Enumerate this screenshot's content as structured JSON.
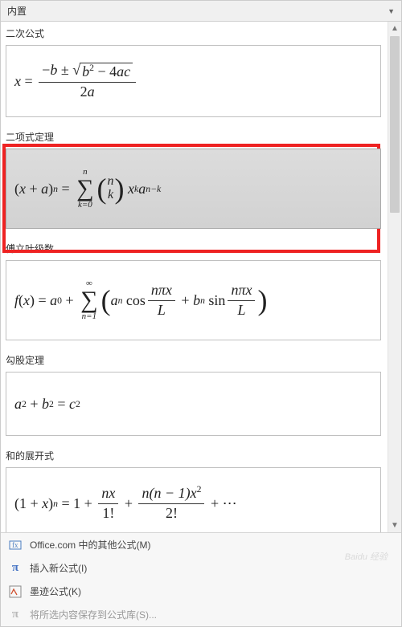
{
  "header": {
    "title": "内置"
  },
  "sections": {
    "quadratic": {
      "title": "二次公式"
    },
    "binomial": {
      "title": "二项式定理"
    },
    "fourier": {
      "title": "傅立叶级数"
    },
    "pythag": {
      "title": "勾股定理"
    },
    "sumexp": {
      "title": "和的展开式"
    }
  },
  "menu": {
    "office": "Office.com 中的其他公式(M)",
    "insert": "插入新公式(I)",
    "ink": "墨迹公式(K)",
    "save": "将所选内容保存到公式库(S)..."
  },
  "sym": {
    "x": "x",
    "eq": "=",
    "minus": "−",
    "b": "b",
    "pm": "±",
    "bsq": "b",
    "two": "2",
    "four": "4",
    "a": "a",
    "c": "c",
    "den2a": "2a",
    "plus": "+",
    "n": "n",
    "k": "k",
    "k0": "k=0",
    "nmk": "n−k",
    "inf": "∞",
    "n1": "n=1",
    "fx": "f",
    "lpar": "(",
    "rpar": ")",
    "a0": "a",
    "sub0": "0",
    "an": "a",
    "subn": "n",
    "cos": "cos",
    "sin": "sin",
    "npi": "nπx",
    "L": "L",
    "bn": "b",
    "c2": "c",
    "one": "1",
    "onep": "(1 + x)",
    "oneeq": "1",
    "nx": "nx",
    "fact1": "1!",
    "nn1": "n(n − 1)x",
    "fact2": "2!",
    "dots": "+ ⋯"
  }
}
